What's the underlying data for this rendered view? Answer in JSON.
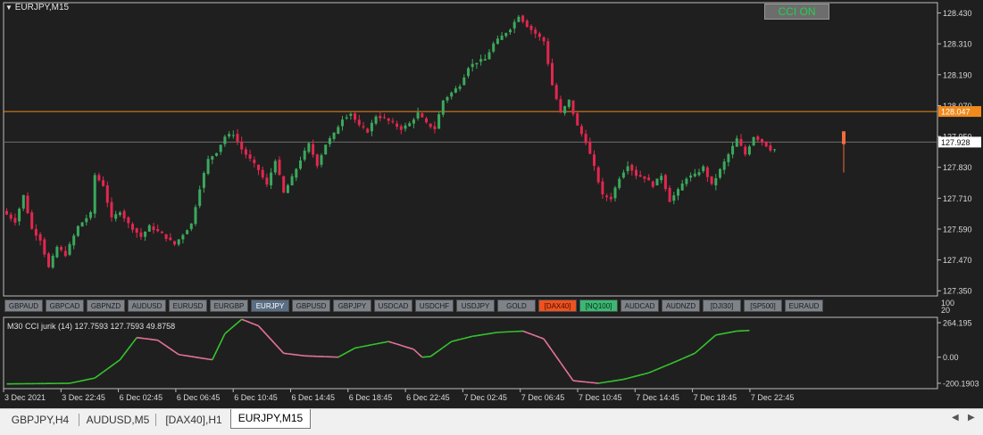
{
  "window": {
    "title": "EURJPY,M15"
  },
  "cci_button": {
    "label": "CCI ON",
    "state": "on"
  },
  "price_axis": {
    "ticks": [
      "128.430",
      "128.310",
      "128.190",
      "128.070",
      "127.950",
      "127.830",
      "127.710",
      "127.590",
      "127.470",
      "127.350"
    ],
    "orange_line": {
      "label": "128.047",
      "color": "#f08a1d"
    },
    "current_price": {
      "label": "127.928"
    }
  },
  "symbol_bar": [
    {
      "label": "GBPAUD",
      "color": "#7e838a"
    },
    {
      "label": "GBPCAD",
      "color": "#7e838a"
    },
    {
      "label": "GBPNZD",
      "color": "#7e838a"
    },
    {
      "label": "AUDUSD",
      "color": "#7e838a"
    },
    {
      "label": "EURUSD",
      "color": "#7e838a"
    },
    {
      "label": "EURGBP",
      "color": "#7e838a"
    },
    {
      "label": "EURJPY",
      "color": "#5a6e85",
      "active": true
    },
    {
      "label": "GBPUSD",
      "color": "#7e838a"
    },
    {
      "label": "GBPJPY",
      "color": "#7e838a"
    },
    {
      "label": "USDCAD",
      "color": "#7e838a"
    },
    {
      "label": "USDCHF",
      "color": "#7e838a"
    },
    {
      "label": "USDJPY",
      "color": "#7e838a"
    },
    {
      "label": "GOLD",
      "color": "#7e838a"
    },
    {
      "label": "[DAX40]",
      "color": "#f0511e"
    },
    {
      "label": "[NQ100]",
      "color": "#3ab872"
    },
    {
      "label": "AUDCAD",
      "color": "#7e838a"
    },
    {
      "label": "AUDNZD",
      "color": "#7e838a"
    },
    {
      "label": "[DJI30]",
      "color": "#7e838a"
    },
    {
      "label": "[SP500]",
      "color": "#7e838a"
    },
    {
      "label": "EURAUD",
      "color": "#7e838a"
    }
  ],
  "indicator": {
    "label": "M30  CCI jurik (14) 127.7593 127.7593 49.8758",
    "scale_top_labels": [
      "100",
      "20"
    ],
    "axis_ticks": [
      "264.195",
      "0.00",
      "-200.1903"
    ],
    "rising_color": "#35c42e",
    "falling_color": "#e6739a"
  },
  "time_axis": {
    "labels": [
      "3 Dec 2021",
      "3 Dec 22:45",
      "6 Dec 02:45",
      "6 Dec 06:45",
      "6 Dec 10:45",
      "6 Dec 14:45",
      "6 Dec 18:45",
      "6 Dec 22:45",
      "7 Dec 02:45",
      "7 Dec 06:45",
      "7 Dec 10:45",
      "7 Dec 14:45",
      "7 Dec 18:45",
      "7 Dec 22:45"
    ]
  },
  "tabs": [
    {
      "label": "GBPJPY,H4"
    },
    {
      "label": "AUDUSD,M5"
    },
    {
      "label": "[DAX40],H1"
    },
    {
      "label": "EURJPY,M15",
      "active": true
    }
  ],
  "colors": {
    "bull": "#3aa95c",
    "bear": "#e3274f",
    "background": "#1f1f1f",
    "axis_text": "#d8d8d8"
  },
  "chart_data": {
    "type": "candlestick",
    "title": "EURJPY,M15",
    "ylim": [
      127.33,
      128.47
    ],
    "price_path": [
      [
        0,
        127.66
      ],
      [
        3,
        127.62
      ],
      [
        5,
        127.72
      ],
      [
        7,
        127.59
      ],
      [
        9,
        127.55
      ],
      [
        11,
        127.44
      ],
      [
        13,
        127.52
      ],
      [
        15,
        127.49
      ],
      [
        18,
        127.6
      ],
      [
        21,
        127.65
      ],
      [
        22,
        127.8
      ],
      [
        24,
        127.76
      ],
      [
        26,
        127.63
      ],
      [
        28,
        127.66
      ],
      [
        30,
        127.61
      ],
      [
        33,
        127.56
      ],
      [
        35,
        127.6
      ],
      [
        38,
        127.57
      ],
      [
        41,
        127.53
      ],
      [
        43,
        127.57
      ],
      [
        45,
        127.61
      ],
      [
        47,
        127.75
      ],
      [
        49,
        127.86
      ],
      [
        51,
        127.89
      ],
      [
        53,
        127.95
      ],
      [
        55,
        127.96
      ],
      [
        57,
        127.9
      ],
      [
        59,
        127.86
      ],
      [
        61,
        127.82
      ],
      [
        63,
        127.76
      ],
      [
        65,
        127.86
      ],
      [
        67,
        127.73
      ],
      [
        69,
        127.79
      ],
      [
        71,
        127.86
      ],
      [
        73,
        127.92
      ],
      [
        75,
        127.84
      ],
      [
        77,
        127.92
      ],
      [
        79,
        127.96
      ],
      [
        81,
        128.02
      ],
      [
        83,
        128.04
      ],
      [
        85,
        127.99
      ],
      [
        87,
        127.97
      ],
      [
        89,
        128.03
      ],
      [
        91,
        128.02
      ],
      [
        93,
        128.0
      ],
      [
        95,
        127.98
      ],
      [
        97,
        128.0
      ],
      [
        99,
        128.04
      ],
      [
        101,
        128.0
      ],
      [
        103,
        127.98
      ],
      [
        105,
        128.09
      ],
      [
        107,
        128.12
      ],
      [
        109,
        128.15
      ],
      [
        111,
        128.22
      ],
      [
        113,
        128.24
      ],
      [
        115,
        128.25
      ],
      [
        117,
        128.31
      ],
      [
        119,
        128.34
      ],
      [
        121,
        128.37
      ],
      [
        123,
        128.42
      ],
      [
        125,
        128.38
      ],
      [
        127,
        128.35
      ],
      [
        129,
        128.32
      ],
      [
        131,
        128.15
      ],
      [
        133,
        128.04
      ],
      [
        135,
        128.09
      ],
      [
        137,
        127.99
      ],
      [
        139,
        127.93
      ],
      [
        141,
        127.83
      ],
      [
        143,
        127.72
      ],
      [
        145,
        127.71
      ],
      [
        147,
        127.79
      ],
      [
        149,
        127.84
      ],
      [
        151,
        127.8
      ],
      [
        153,
        127.79
      ],
      [
        155,
        127.76
      ],
      [
        157,
        127.8
      ],
      [
        159,
        127.7
      ],
      [
        161,
        127.74
      ],
      [
        163,
        127.79
      ],
      [
        165,
        127.8
      ],
      [
        167,
        127.83
      ],
      [
        169,
        127.76
      ],
      [
        171,
        127.82
      ],
      [
        173,
        127.88
      ],
      [
        175,
        127.94
      ],
      [
        177,
        127.88
      ],
      [
        179,
        127.95
      ],
      [
        181,
        127.93
      ],
      [
        183,
        127.9
      ]
    ],
    "cci_path": [
      [
        0,
        -205
      ],
      [
        15,
        -200
      ],
      [
        21,
        -160
      ],
      [
        27,
        -20
      ],
      [
        31,
        150
      ],
      [
        36,
        130
      ],
      [
        41,
        20
      ],
      [
        49,
        -20
      ],
      [
        52,
        180
      ],
      [
        56,
        290
      ],
      [
        60,
        240
      ],
      [
        66,
        30
      ],
      [
        71,
        10
      ],
      [
        79,
        0
      ],
      [
        83,
        70
      ],
      [
        91,
        120
      ],
      [
        97,
        60
      ],
      [
        99,
        0
      ],
      [
        101,
        5
      ],
      [
        106,
        120
      ],
      [
        111,
        160
      ],
      [
        117,
        190
      ],
      [
        123,
        200
      ],
      [
        128,
        140
      ],
      [
        135,
        -180
      ],
      [
        141,
        -200
      ],
      [
        147,
        -170
      ],
      [
        153,
        -120
      ],
      [
        159,
        -40
      ],
      [
        164,
        30
      ],
      [
        169,
        170
      ],
      [
        174,
        200
      ],
      [
        177,
        205
      ]
    ],
    "candle_count": 184,
    "time_labels": [
      "3 Dec 2021",
      "3 Dec 22:45",
      "6 Dec 02:45",
      "6 Dec 06:45",
      "6 Dec 10:45",
      "6 Dec 14:45",
      "6 Dec 18:45",
      "6 Dec 22:45",
      "7 Dec 02:45",
      "7 Dec 06:45",
      "7 Dec 10:45",
      "7 Dec 14:45",
      "7 Dec 18:45",
      "7 Dec 22:45"
    ],
    "orange_level": 128.047,
    "last_price": 127.928
  }
}
